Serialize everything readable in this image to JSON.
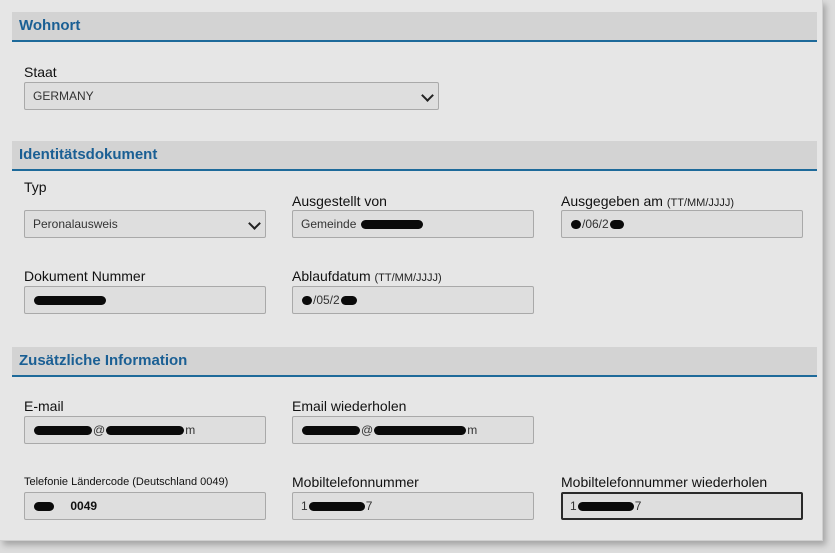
{
  "sections": {
    "residence": {
      "title": "Wohnort",
      "country_label": "Staat",
      "country_value": "GERMANY"
    },
    "identity": {
      "title": "Identitätsdokument",
      "type_label": "Typ",
      "type_value": "Peronalausweis",
      "issued_by_label": "Ausgestellt von",
      "issued_by_value": "Gemeinde",
      "issued_on_label": "Ausgegeben am",
      "issued_on_hint": "(TT/MM/JJJJ)",
      "issued_on_value": "/06/2",
      "doc_number_label": "Dokument Nummer",
      "expiry_label": "Ablaufdatum",
      "expiry_hint": "(TT/MM/JJJJ)",
      "expiry_value": "/05/2"
    },
    "additional": {
      "title": "Zusätzliche Information",
      "email_label": "E-mail",
      "email_value": "@",
      "email_tail": "m",
      "email_repeat_label": "Email wiederholen",
      "email_repeat_value": "@",
      "email_repeat_tail": "m",
      "phone_code_label": "Telefonie Ländercode (Deutschland 0049)",
      "phone_code_value": "0049",
      "mobile_label": "Mobiltelefonnummer",
      "mobile_value": "1",
      "mobile_tail": "7",
      "mobile_repeat_label": "Mobiltelefonnummer wiederholen",
      "mobile_repeat_value": "1",
      "mobile_repeat_tail": "7"
    }
  }
}
